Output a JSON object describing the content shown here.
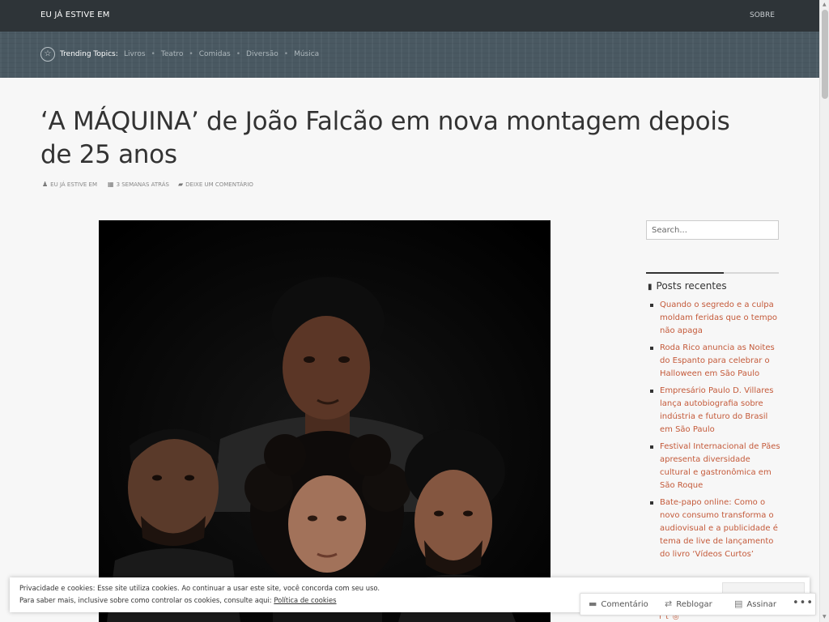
{
  "header": {
    "site_title": "EU JÁ ESTIVE EM",
    "nav_about": "SOBRE"
  },
  "trending": {
    "label": "Trending Topics:",
    "topics": [
      "Livros",
      "Teatro",
      "Comidas",
      "Diversão",
      "Música"
    ]
  },
  "post": {
    "title": "‘A MÁQUINA’ de João Falcão em nova montagem depois de 25 anos",
    "author": "EU JÁ ESTIVE EM",
    "date": "3 SEMANAS ATRÁS",
    "comment_link": "DEIXE UM COMENTÁRIO"
  },
  "sidebar": {
    "search_placeholder": "Search...",
    "recent_title": "Posts recentes",
    "recent_posts": [
      "Quando o segredo e a culpa moldam feridas que o tempo não apaga",
      "Roda Rico anuncia as Noites do Espanto para celebrar o Halloween em São Paulo",
      "Empresário Paulo D. Villares lança autobiografia sobre indústria e futuro do Brasil em São Paulo",
      "Festival Internacional de Pães apresenta diversidade cultural e gastronômica em São Roque",
      "Bate-papo online: Como o novo consumo transforma o audiovisual e a publicidade é tema de live de lançamento do livro ‘Vídeos Curtos’"
    ]
  },
  "cookie": {
    "line1": "Privacidade e cookies: Esse site utiliza cookies. Ao continuar a usar este site, você concorda com seu uso.",
    "line2": "Para saber mais, inclusive sobre como controlar os cookies, consulte aqui:",
    "policy_link": "Política de cookies"
  },
  "actions": {
    "comment": "Comentário",
    "reblog": "Reblogar",
    "subscribe": "Assinar",
    "more": "•••"
  },
  "colors": {
    "topbar": "#2e3438",
    "trendbar": "#4a5962",
    "link_accent": "#c45a3a",
    "background": "#f7f7f7"
  },
  "icons": {
    "trending": "star-circle-icon",
    "author": "user-icon",
    "date": "calendar-icon",
    "comments": "comment-bubble-icon",
    "recent_posts": "book-icon",
    "comment_action": "comment-icon",
    "reblog_action": "reblog-icon",
    "subscribe_action": "subscribe-icon"
  }
}
